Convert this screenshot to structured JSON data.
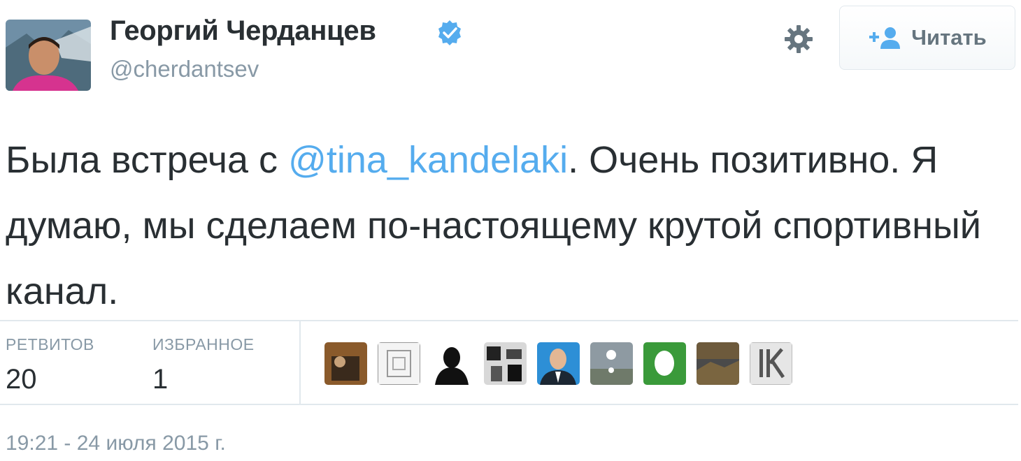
{
  "author": {
    "name": "Георгий Черданцев",
    "handle": "@cherdantsev",
    "verified": true
  },
  "actions": {
    "settings_icon": "gear-icon",
    "follow_label": "Читать",
    "follow_icon": "add-user-icon"
  },
  "tweet": {
    "text_before": "Была встреча с ",
    "mention": "@tina_kandelaki",
    "text_after": ". Очень позитивно. Я думаю, мы сделаем по-настоящему крутой спортивный канал."
  },
  "stats": {
    "retweets_label": "РЕТВИТОВ",
    "retweets_count": "20",
    "favorites_label": "ИЗБРАННОЕ",
    "favorites_count": "1"
  },
  "favoriters": [
    "user-avatar-1",
    "user-avatar-2",
    "user-avatar-3",
    "user-avatar-4",
    "user-avatar-5",
    "user-avatar-6",
    "user-avatar-7",
    "user-avatar-8",
    "user-avatar-9"
  ],
  "timestamp": "19:21 - 24 июля 2015 г.",
  "colors": {
    "link": "#55acee",
    "text": "#292f33",
    "muted": "#8899a6",
    "border": "#e1e8ed"
  }
}
